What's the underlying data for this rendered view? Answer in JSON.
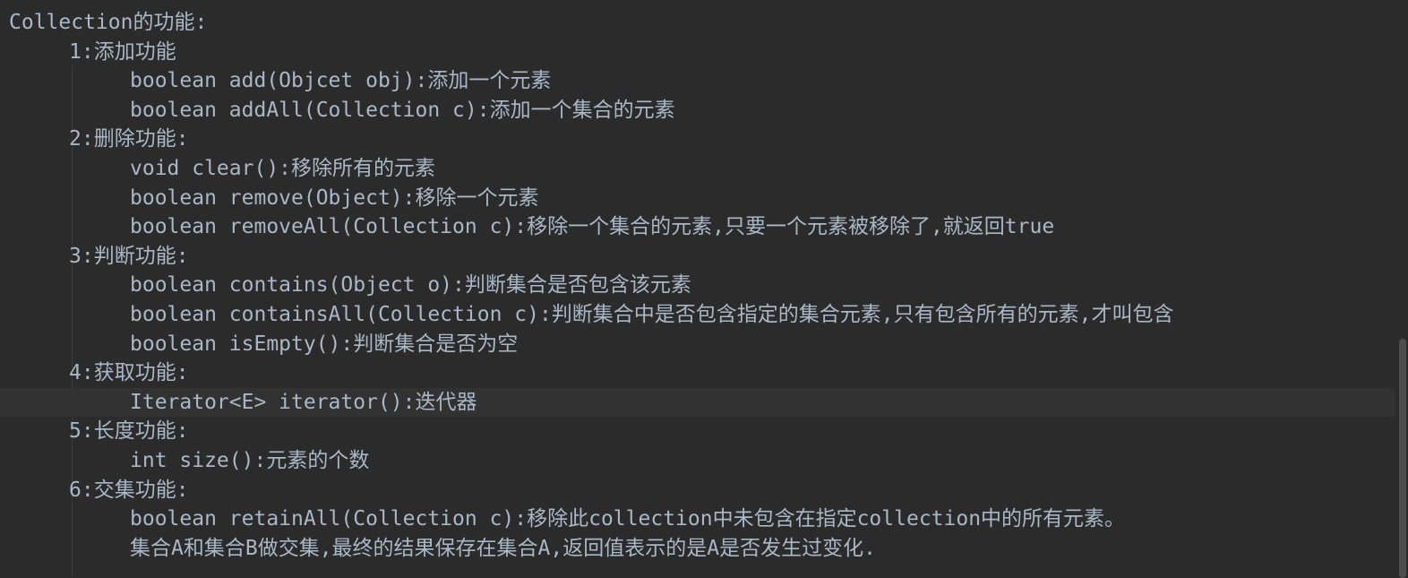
{
  "editor": {
    "lines": [
      "Collection的功能:",
      "1:添加功能",
      "boolean add(Objcet obj):添加一个元素",
      "boolean addAll(Collection c):添加一个集合的元素",
      "2:删除功能:",
      "void clear():移除所有的元素",
      "boolean remove(Object):移除一个元素",
      "boolean removeAll(Collection c):移除一个集合的元素,只要一个元素被移除了,就返回true",
      "3:判断功能:",
      "boolean contains(Object o):判断集合是否包含该元素",
      "boolean containsAll(Collection c):判断集合中是否包含指定的集合元素,只有包含所有的元素,才叫包含",
      "boolean isEmpty():判断集合是否为空",
      "4:获取功能:",
      "Iterator<E> iterator():迭代器",
      "5:长度功能:",
      "int size():元素的个数",
      "6:交集功能:",
      "boolean retainAll(Collection c):移除此collection中未包含在指定collection中的所有元素。",
      "集合A和集合B做交集,最终的结果保存在集合A,返回值表示的是A是否发生过变化."
    ],
    "current_line_index": 13,
    "colors": {
      "background": "#2b2b2b",
      "text": "#a9b7c6",
      "current_line": "#323232",
      "typo_underline": "#629755"
    }
  }
}
